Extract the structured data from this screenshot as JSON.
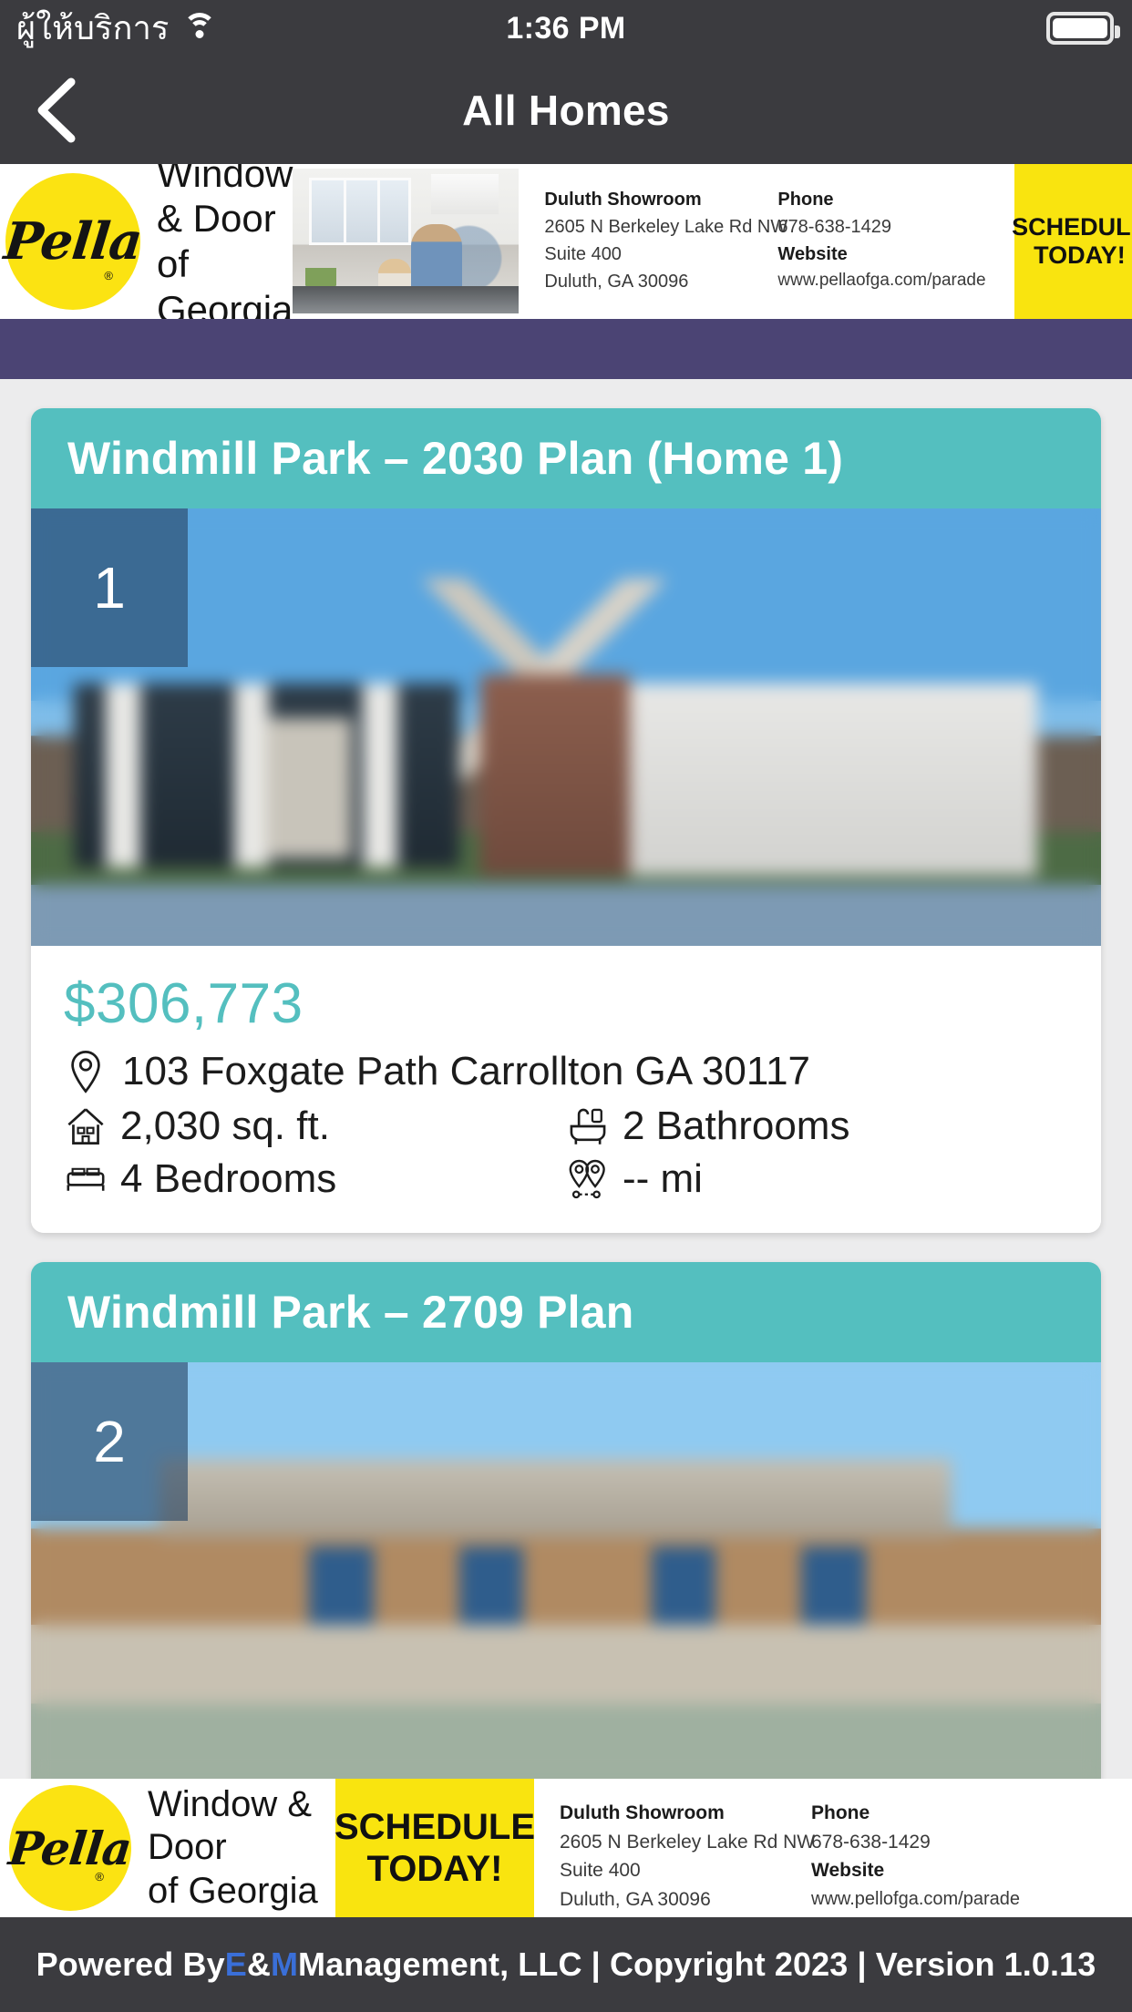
{
  "status_bar": {
    "carrier": "ผู้ให้บริการ",
    "wifi_icon": "wifi-icon",
    "time": "1:36 PM",
    "battery_icon": "battery-full-icon"
  },
  "nav": {
    "back_icon": "chevron-left-icon",
    "title": "All Homes"
  },
  "ad_top": {
    "brand": "Pella",
    "brand_line1": "Window & Door",
    "brand_line2": "of Georgia",
    "registered_mark": "®",
    "showroom_label": "Duluth Showroom",
    "address_line1": "2605 N Berkeley Lake Rd NW",
    "address_line2": "Suite 400",
    "address_line3": "Duluth, GA 30096",
    "phone_label": "Phone",
    "phone": "678-638-1429",
    "website_label": "Website",
    "website": "www.pellaofga.com/parade",
    "cta_line1": "SCHEDULE",
    "cta_line2": "TODAY!"
  },
  "ad_bottom": {
    "brand": "Pella",
    "brand_line1": "Window & Door",
    "brand_line2": "of Georgia",
    "registered_mark": "®",
    "showroom_label": "Duluth Showroom",
    "address_line1": "2605 N Berkeley Lake Rd NW",
    "address_line2": "Suite 400",
    "address_line3": "Duluth, GA 30096",
    "phone_label": "Phone",
    "phone": "678-638-1429",
    "website_label": "Website",
    "website": "www.pellofga.com/parade",
    "cta_line1": "SCHEDULE",
    "cta_line2": "TODAY!"
  },
  "listings": [
    {
      "title": "Windmill Park – 2030 Plan (Home 1)",
      "badge": "1",
      "price": "$306,773",
      "address": "103 Foxgate Path Carrollton GA 30117",
      "address_icon": "map-pin-icon",
      "sqft": "2,030 sq. ft.",
      "sqft_icon": "house-icon",
      "bathrooms": "2 Bathrooms",
      "bathrooms_icon": "bathtub-icon",
      "bedrooms": "4 Bedrooms",
      "bedrooms_icon": "bed-icon",
      "distance": "-- mi",
      "distance_icon": "route-pins-icon"
    },
    {
      "title": "Windmill Park – 2709 Plan",
      "badge": "2"
    }
  ],
  "footer": {
    "prefix": "Powered By ",
    "brand_e": "E",
    "brand_amp": "&",
    "brand_m": "M",
    "suffix": " Management, LLC | Copyright 2023 | Version 1.0.13"
  },
  "colors": {
    "nav_bg": "#3b3b3f",
    "accent_teal": "#54bfbf",
    "purple_band": "#4b4474",
    "cta_yellow": "#f9e40f",
    "footer_blue": "#3a6fd8",
    "page_bg": "#ececed"
  }
}
